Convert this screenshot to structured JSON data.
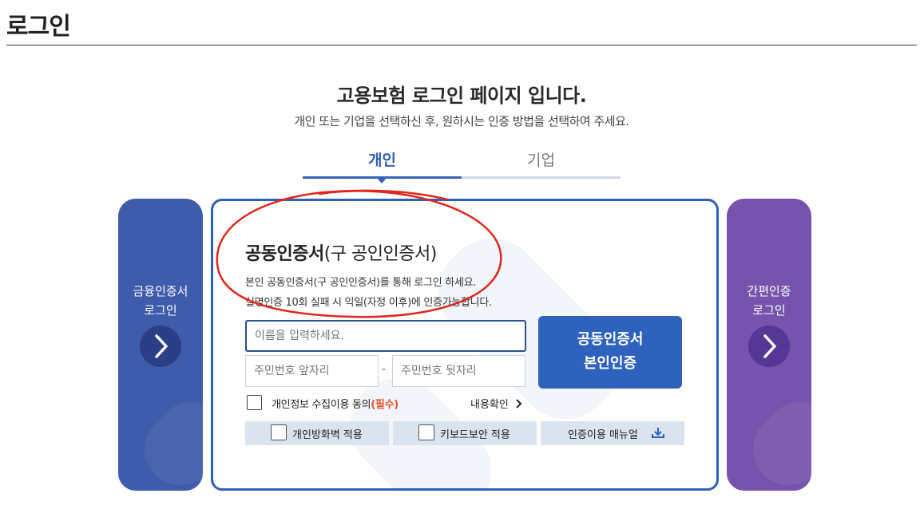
{
  "page": {
    "title": "로그인"
  },
  "header": {
    "heading": "고용보험 로그인 페이지 입니다.",
    "subheading": "개인 또는 기업을 선택하신 후, 원하시는 인증 방법을 선택하여 주세요."
  },
  "tabs": [
    {
      "label": "개인",
      "active": true
    },
    {
      "label": "기업",
      "active": false
    }
  ],
  "left_card": {
    "line1": "금융인증서",
    "line2": "로그인",
    "color": "#3f5bab"
  },
  "right_card": {
    "line1": "간편인증",
    "line2": "로그인",
    "color": "#7654ad"
  },
  "main_card": {
    "title_bold": "공동인증서",
    "title_rest": "(구 공인인증서)",
    "desc_line1": "본인 공동인증서(구 공인인증서)를 통해 로그인 하세요.",
    "desc_line2": "실명인증 10회 실패 시 익일(자정 이후)에 인증가능합니다.",
    "name_placeholder": "이름을 입력하세요.",
    "rrn_front_placeholder": "주민번호 앞자리",
    "rrn_separator": "-",
    "rrn_back_placeholder": "주민번호 뒷자리",
    "submit_line1": "공동인증서",
    "submit_line2": "본인인증",
    "consent_label": "개인정보 수집이용 동의",
    "consent_required": "(필수)",
    "view_details": "내용확인",
    "options": {
      "firewall": "개인방화벽 적용",
      "keyboard": "키보드보안 적용",
      "manual": "인증이용 매뉴얼"
    },
    "accent_color": "#2f62bd",
    "annotation_color": "#e0271f"
  }
}
